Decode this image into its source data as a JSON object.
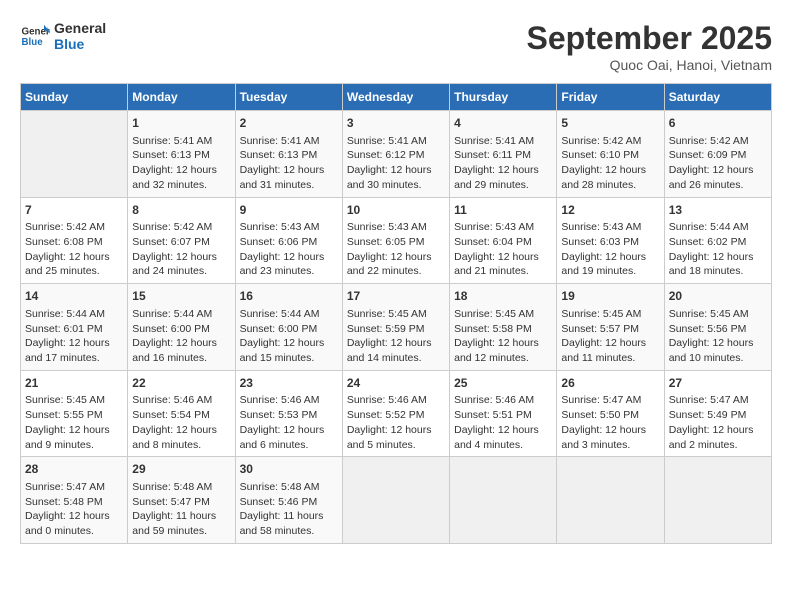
{
  "logo": {
    "line1": "General",
    "line2": "Blue"
  },
  "title": "September 2025",
  "location": "Quoc Oai, Hanoi, Vietnam",
  "weekdays": [
    "Sunday",
    "Monday",
    "Tuesday",
    "Wednesday",
    "Thursday",
    "Friday",
    "Saturday"
  ],
  "weeks": [
    [
      {
        "day": "",
        "info": ""
      },
      {
        "day": "1",
        "info": "Sunrise: 5:41 AM\nSunset: 6:13 PM\nDaylight: 12 hours\nand 32 minutes."
      },
      {
        "day": "2",
        "info": "Sunrise: 5:41 AM\nSunset: 6:13 PM\nDaylight: 12 hours\nand 31 minutes."
      },
      {
        "day": "3",
        "info": "Sunrise: 5:41 AM\nSunset: 6:12 PM\nDaylight: 12 hours\nand 30 minutes."
      },
      {
        "day": "4",
        "info": "Sunrise: 5:41 AM\nSunset: 6:11 PM\nDaylight: 12 hours\nand 29 minutes."
      },
      {
        "day": "5",
        "info": "Sunrise: 5:42 AM\nSunset: 6:10 PM\nDaylight: 12 hours\nand 28 minutes."
      },
      {
        "day": "6",
        "info": "Sunrise: 5:42 AM\nSunset: 6:09 PM\nDaylight: 12 hours\nand 26 minutes."
      }
    ],
    [
      {
        "day": "7",
        "info": "Sunrise: 5:42 AM\nSunset: 6:08 PM\nDaylight: 12 hours\nand 25 minutes."
      },
      {
        "day": "8",
        "info": "Sunrise: 5:42 AM\nSunset: 6:07 PM\nDaylight: 12 hours\nand 24 minutes."
      },
      {
        "day": "9",
        "info": "Sunrise: 5:43 AM\nSunset: 6:06 PM\nDaylight: 12 hours\nand 23 minutes."
      },
      {
        "day": "10",
        "info": "Sunrise: 5:43 AM\nSunset: 6:05 PM\nDaylight: 12 hours\nand 22 minutes."
      },
      {
        "day": "11",
        "info": "Sunrise: 5:43 AM\nSunset: 6:04 PM\nDaylight: 12 hours\nand 21 minutes."
      },
      {
        "day": "12",
        "info": "Sunrise: 5:43 AM\nSunset: 6:03 PM\nDaylight: 12 hours\nand 19 minutes."
      },
      {
        "day": "13",
        "info": "Sunrise: 5:44 AM\nSunset: 6:02 PM\nDaylight: 12 hours\nand 18 minutes."
      }
    ],
    [
      {
        "day": "14",
        "info": "Sunrise: 5:44 AM\nSunset: 6:01 PM\nDaylight: 12 hours\nand 17 minutes."
      },
      {
        "day": "15",
        "info": "Sunrise: 5:44 AM\nSunset: 6:00 PM\nDaylight: 12 hours\nand 16 minutes."
      },
      {
        "day": "16",
        "info": "Sunrise: 5:44 AM\nSunset: 6:00 PM\nDaylight: 12 hours\nand 15 minutes."
      },
      {
        "day": "17",
        "info": "Sunrise: 5:45 AM\nSunset: 5:59 PM\nDaylight: 12 hours\nand 14 minutes."
      },
      {
        "day": "18",
        "info": "Sunrise: 5:45 AM\nSunset: 5:58 PM\nDaylight: 12 hours\nand 12 minutes."
      },
      {
        "day": "19",
        "info": "Sunrise: 5:45 AM\nSunset: 5:57 PM\nDaylight: 12 hours\nand 11 minutes."
      },
      {
        "day": "20",
        "info": "Sunrise: 5:45 AM\nSunset: 5:56 PM\nDaylight: 12 hours\nand 10 minutes."
      }
    ],
    [
      {
        "day": "21",
        "info": "Sunrise: 5:45 AM\nSunset: 5:55 PM\nDaylight: 12 hours\nand 9 minutes."
      },
      {
        "day": "22",
        "info": "Sunrise: 5:46 AM\nSunset: 5:54 PM\nDaylight: 12 hours\nand 8 minutes."
      },
      {
        "day": "23",
        "info": "Sunrise: 5:46 AM\nSunset: 5:53 PM\nDaylight: 12 hours\nand 6 minutes."
      },
      {
        "day": "24",
        "info": "Sunrise: 5:46 AM\nSunset: 5:52 PM\nDaylight: 12 hours\nand 5 minutes."
      },
      {
        "day": "25",
        "info": "Sunrise: 5:46 AM\nSunset: 5:51 PM\nDaylight: 12 hours\nand 4 minutes."
      },
      {
        "day": "26",
        "info": "Sunrise: 5:47 AM\nSunset: 5:50 PM\nDaylight: 12 hours\nand 3 minutes."
      },
      {
        "day": "27",
        "info": "Sunrise: 5:47 AM\nSunset: 5:49 PM\nDaylight: 12 hours\nand 2 minutes."
      }
    ],
    [
      {
        "day": "28",
        "info": "Sunrise: 5:47 AM\nSunset: 5:48 PM\nDaylight: 12 hours\nand 0 minutes."
      },
      {
        "day": "29",
        "info": "Sunrise: 5:48 AM\nSunset: 5:47 PM\nDaylight: 11 hours\nand 59 minutes."
      },
      {
        "day": "30",
        "info": "Sunrise: 5:48 AM\nSunset: 5:46 PM\nDaylight: 11 hours\nand 58 minutes."
      },
      {
        "day": "",
        "info": ""
      },
      {
        "day": "",
        "info": ""
      },
      {
        "day": "",
        "info": ""
      },
      {
        "day": "",
        "info": ""
      }
    ]
  ]
}
